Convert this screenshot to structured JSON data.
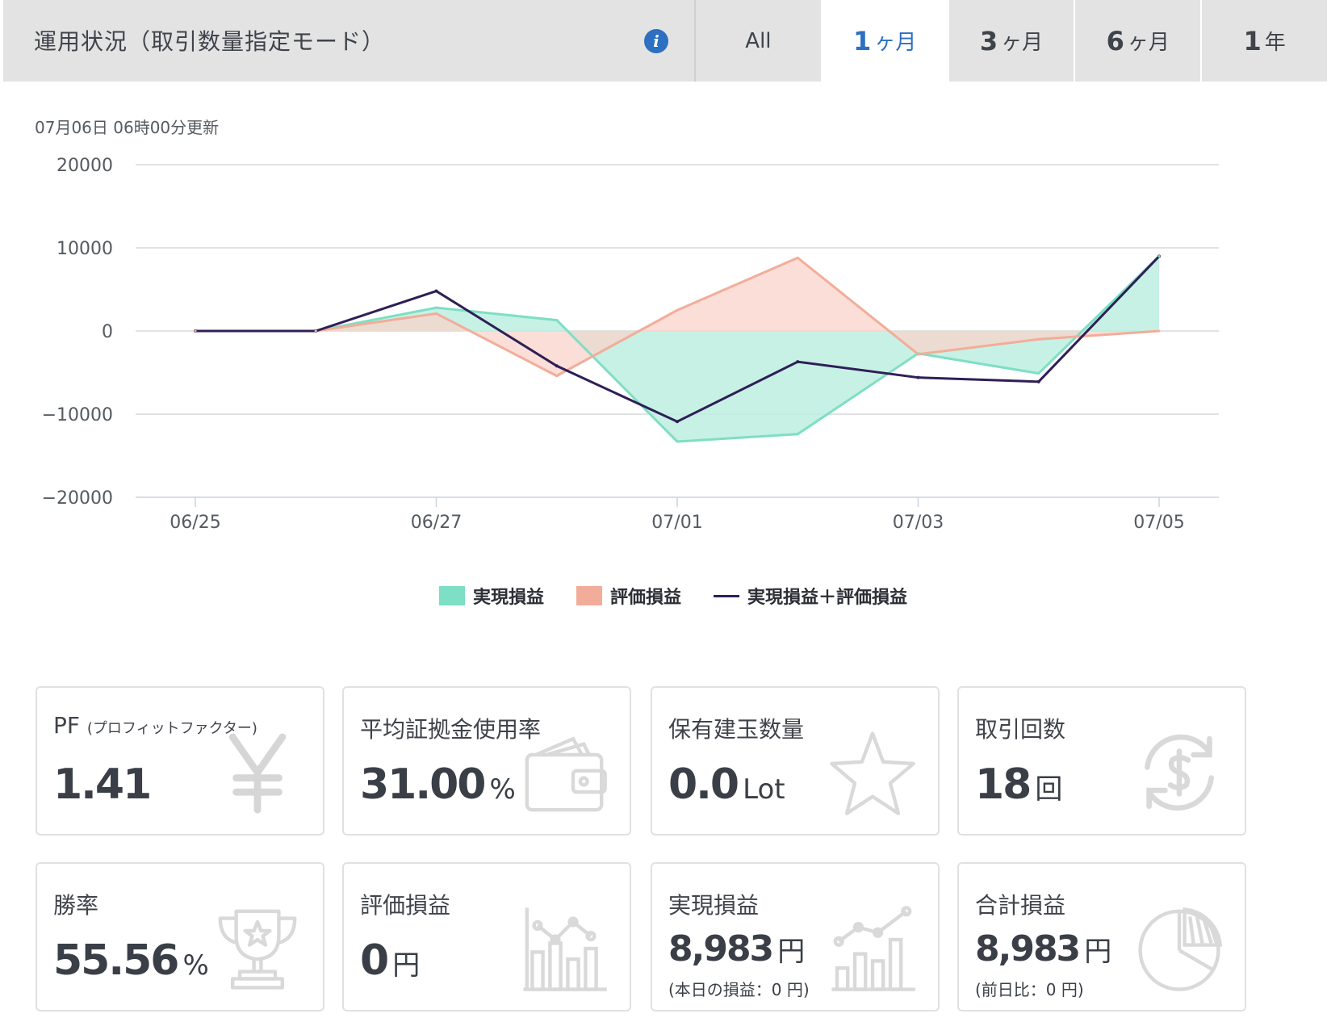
{
  "header": {
    "title": "運用状況（取引数量指定モード）",
    "info_icon": "i",
    "tabs": [
      {
        "num": "All",
        "unit": "",
        "active": false
      },
      {
        "num": "1",
        "unit": "ヶ月",
        "active": true
      },
      {
        "num": "3",
        "unit": "ヶ月",
        "active": false
      },
      {
        "num": "6",
        "unit": "ヶ月",
        "active": false
      },
      {
        "num": "1",
        "unit": "年",
        "active": false
      }
    ]
  },
  "updated": "07月06日 06時00分更新",
  "colors": {
    "realized": "#7ddfc3",
    "realized_fill": "#bdeee0",
    "unrealized": "#f2ad9a",
    "unrealized_fill": "#f8d3c9",
    "total": "#2e1f57",
    "accent": "#2d6fc0"
  },
  "chart_data": {
    "type": "area",
    "x": [
      "06/25",
      "06/26",
      "06/27",
      "06/28",
      "07/01",
      "07/02",
      "07/03",
      "07/04",
      "07/05"
    ],
    "x_tick_labels": [
      "06/25",
      "06/27",
      "07/01",
      "07/03",
      "07/05"
    ],
    "y_ticks": [
      20000,
      10000,
      0,
      -10000,
      -20000
    ],
    "y_tick_labels": [
      "20000",
      "10000",
      "0",
      "−10000",
      "−20000"
    ],
    "ylim": [
      -20000,
      20000
    ],
    "series": [
      {
        "name": "実現損益",
        "type": "area",
        "values": [
          0,
          0,
          2800,
          1300,
          -13300,
          -12400,
          -2700,
          -5100,
          8983
        ]
      },
      {
        "name": "評価損益",
        "type": "area",
        "values": [
          0,
          0,
          2100,
          -5400,
          2500,
          8800,
          -2800,
          -1000,
          0
        ]
      },
      {
        "name": "実現損益＋評価損益",
        "type": "line",
        "values": [
          0,
          0,
          4800,
          -4200,
          -10900,
          -3700,
          -5600,
          -6100,
          8983
        ]
      }
    ],
    "grid": true,
    "legend": "bottom-center"
  },
  "stats": [
    {
      "label": "PF",
      "label_sub": "(プロフィットファクター)",
      "value": "1.41",
      "unit": "",
      "note": "",
      "icon": "yen-icon"
    },
    {
      "label": "平均証拠金使用率",
      "label_sub": "",
      "value": "31.00",
      "unit": "%",
      "note": "",
      "icon": "wallet-icon"
    },
    {
      "label": "保有建玉数量",
      "label_sub": "",
      "value": "0.0",
      "unit": "Lot",
      "note": "",
      "icon": "star-icon"
    },
    {
      "label": "取引回数",
      "label_sub": "",
      "value": "18",
      "unit": "回",
      "note": "",
      "icon": "dollar-exchange-icon"
    },
    {
      "label": "勝率",
      "label_sub": "",
      "value": "55.56",
      "unit": "%",
      "note": "",
      "icon": "trophy-icon"
    },
    {
      "label": "評価損益",
      "label_sub": "",
      "value": "0",
      "unit": "円",
      "note": "",
      "icon": "bar-line-chart-icon"
    },
    {
      "label": "実現損益",
      "label_sub": "",
      "value": "8,983",
      "unit": "円",
      "note": "(本日の損益：0 円)",
      "icon": "growth-chart-icon"
    },
    {
      "label": "合計損益",
      "label_sub": "",
      "value": "8,983",
      "unit": "円",
      "note": "(前日比：0 円)",
      "icon": "pie-chart-icon"
    }
  ]
}
